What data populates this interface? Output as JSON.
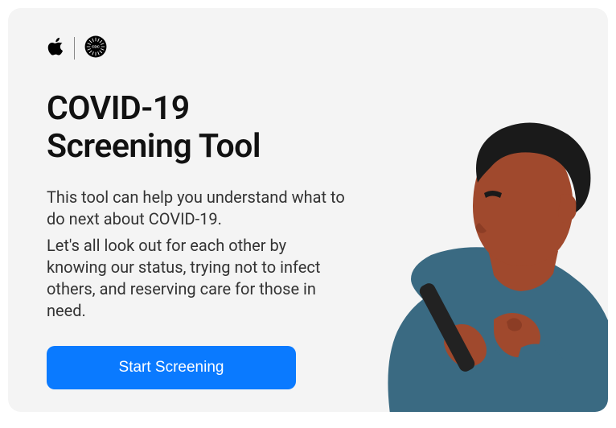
{
  "title_line1": "COVID-19",
  "title_line2": "Screening Tool",
  "paragraph1": "This tool can help you understand what to do next about COVID-19.",
  "paragraph2": "Let's all look out for each other by knowing our status, trying not to infect others, and reserving care for those in need.",
  "button_label": "Start Screening",
  "colors": {
    "card_bg": "#f4f4f4",
    "button_bg": "#0a7aff",
    "text_primary": "#111",
    "text_body": "#333",
    "skin": "#a0492d",
    "hair": "#1a1a1a",
    "shirt": "#3a6a82",
    "phone": "#222"
  }
}
